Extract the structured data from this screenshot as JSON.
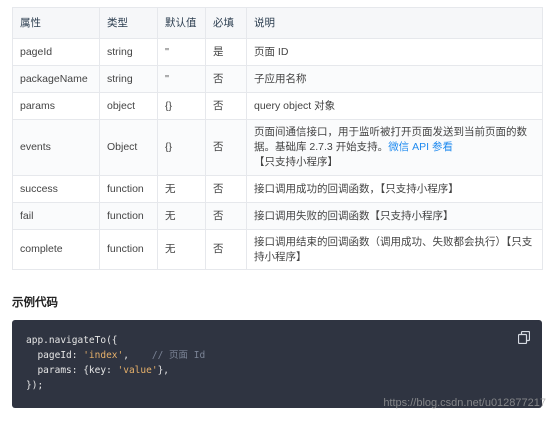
{
  "table": {
    "headers": [
      "属性",
      "类型",
      "默认值",
      "必填",
      "说明"
    ],
    "rows": [
      {
        "name": "pageId",
        "type": "string",
        "default": "''",
        "required": "是",
        "desc": "页面 ID"
      },
      {
        "name": "packageName",
        "type": "string",
        "default": "''",
        "required": "否",
        "desc": "子应用名称"
      },
      {
        "name": "params",
        "type": "object",
        "default": "{}",
        "required": "否",
        "desc": "query object 对象"
      },
      {
        "name": "events",
        "type": "Object",
        "default": "{}",
        "required": "否",
        "desc_pre": "页面间通信接口，用于监听被打开页面发送到当前页面的数据。基础库 2.7.3 开始支持。",
        "desc_link": "微信 API 参看",
        "desc_post": "【只支持小程序】"
      },
      {
        "name": "success",
        "type": "function",
        "default": "无",
        "required": "否",
        "desc": "接口调用成功的回调函数，【只支持小程序】"
      },
      {
        "name": "fail",
        "type": "function",
        "default": "无",
        "required": "否",
        "desc": "接口调用失败的回调函数【只支持小程序】"
      },
      {
        "name": "complete",
        "type": "function",
        "default": "无",
        "required": "否",
        "desc": "接口调用结束的回调函数（调用成功、失败都会执行）【只支持小程序】"
      }
    ]
  },
  "example": {
    "title": "示例代码",
    "line1": "app.navigateTo({",
    "line2_key": "  pageId: ",
    "line2_val": "'index'",
    "line2_sep": ",    ",
    "line2_comment": "// 页面 Id",
    "line3_key": "  params: {key: ",
    "line3_val": "'value'",
    "line3_end": "},",
    "line4": "});"
  },
  "watermark": "https://blog.csdn.net/u012877217",
  "icons": {
    "copy": "copy-icon"
  },
  "colors": {
    "link": "#1f8aef",
    "code_bg": "#2f3441",
    "code_string": "#e6b06a",
    "code_comment": "#7b8496"
  }
}
